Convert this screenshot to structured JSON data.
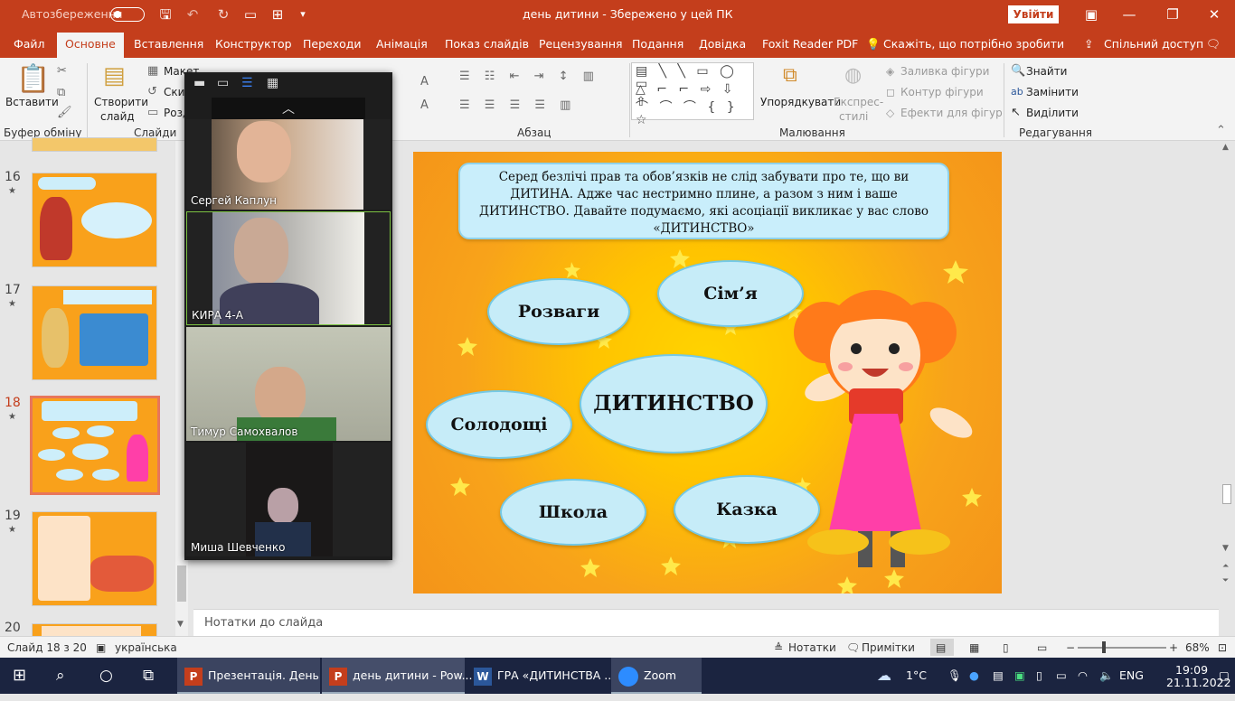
{
  "titlebar": {
    "autosave_label": "Автозбереження",
    "autosave_state": "off",
    "doc_title": "день дитини  -  Збережено у цей ПК",
    "signin": "Увійти"
  },
  "menu": {
    "items": [
      "Файл",
      "Основне",
      "Вставлення",
      "Конструктор",
      "Переходи",
      "Анімація",
      "Показ слайдів",
      "Рецензування",
      "Подання",
      "Довідка",
      "Foxit Reader PDF"
    ],
    "active": "Основне",
    "tell_me": "Скажіть, що потрібно зробити",
    "share": "Спільний доступ"
  },
  "ribbon": {
    "clipboard": {
      "paste": "Вставити",
      "group": "Буфер обміну"
    },
    "slides": {
      "new_slide": "Створити",
      "new_slide2": "слайд",
      "layout": "Макет",
      "reset": "Скин",
      "section": "Розд",
      "group": "Слайди"
    },
    "paragraph": {
      "group": "Абзац"
    },
    "drawing": {
      "arrange": "Упорядкувати",
      "quick1": "Експрес-",
      "quick2": "стилі",
      "fill": "Заливка фігури",
      "outline": "Контур фігури",
      "effects": "Ефекти для фігур",
      "group": "Малювання"
    },
    "editing": {
      "find": "Знайти",
      "replace": "Замінити",
      "select": "Виділити",
      "group": "Редагування"
    }
  },
  "thumbnails": [
    {
      "num": "16",
      "star": "★"
    },
    {
      "num": "17",
      "star": "★"
    },
    {
      "num": "18",
      "star": "★"
    },
    {
      "num": "19",
      "star": "★"
    },
    {
      "num": "20",
      "star": ""
    }
  ],
  "zoom_participants": [
    "Сергей Каплун",
    "КИРА 4-А",
    "Тимур Самохвалов",
    "Миша Шевченко"
  ],
  "slide": {
    "intro": "Серед безлічі прав та обов’язків не слід забувати про те, що ви ДИТИНА. Адже час нестримно плине, а разом з ним і ваше ДИТИНСТВО. Давайте подумаємо,  які асоціації викликає у вас слово «ДИТИНСТВО»",
    "center": "ДИТИНСТВО",
    "clouds": [
      "Розваги",
      "Сім’я",
      "Солодощі",
      "Школа",
      "Казка"
    ]
  },
  "notes_placeholder": "Нотатки до слайда",
  "status": {
    "slide_info": "Слайд 18 з 20",
    "language": "українська",
    "notes": "Нотатки",
    "comments": "Примітки",
    "zoom": "68%"
  },
  "taskbar": {
    "apps": [
      "Презентація. День ...",
      "день дитини - Pow...",
      "ГРА «ДИТИНСТВА ...",
      "Zoom"
    ],
    "weather": "1°C",
    "lang": "ENG",
    "time": "19:09",
    "date": "21.11.2022"
  }
}
